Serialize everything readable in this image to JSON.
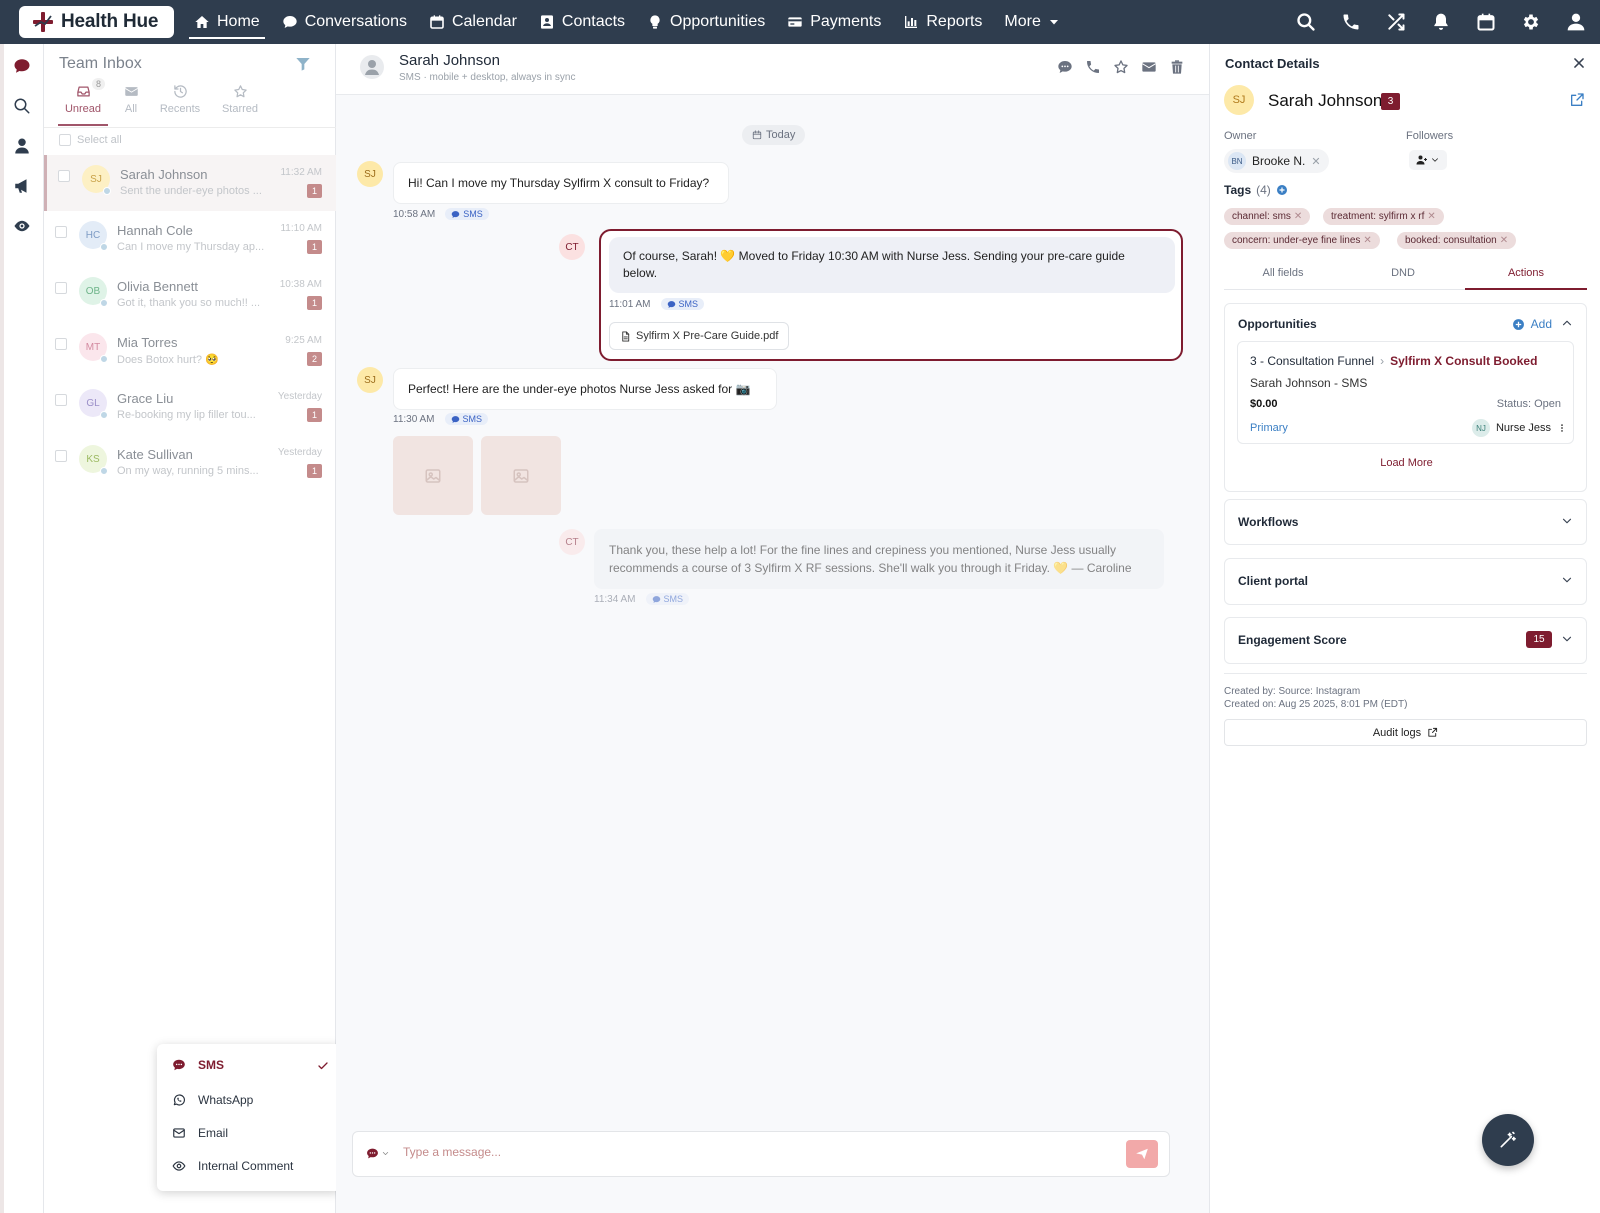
{
  "brand": {
    "name": "Health Hue"
  },
  "nav": [
    {
      "label": "Home",
      "icon": "home-icon",
      "active": true
    },
    {
      "label": "Conversations",
      "icon": "chat-icon"
    },
    {
      "label": "Calendar",
      "icon": "calendar-icon"
    },
    {
      "label": "Contacts",
      "icon": "contacts-icon"
    },
    {
      "label": "Opportunities",
      "icon": "lightbulb-icon"
    },
    {
      "label": "Payments",
      "icon": "card-icon"
    },
    {
      "label": "Reports",
      "icon": "bar-chart-icon"
    },
    {
      "label": "More",
      "icon": "caret-down-icon"
    }
  ],
  "top_icons": [
    "search-icon",
    "phone-icon",
    "shuffle-icon",
    "bell-icon",
    "calendar-icon",
    "gear-icon",
    "user-icon"
  ],
  "rail_icons": [
    "chat-icon",
    "search-icon",
    "user-icon",
    "megaphone-icon",
    "eye-icon"
  ],
  "inbox": {
    "title": "Team Inbox",
    "unread_count": "8",
    "tabs": [
      {
        "label": "Unread",
        "icon": "inbox-icon",
        "active": true
      },
      {
        "label": "All",
        "icon": "mail-icon"
      },
      {
        "label": "Recents",
        "icon": "history-icon"
      },
      {
        "label": "Starred",
        "icon": "star-icon"
      }
    ],
    "select_all": "Select all",
    "conversations": [
      {
        "initials": "SJ",
        "name": "Sarah Johnson",
        "preview": "Sent the under-eye photos ...",
        "time": "11:32 AM",
        "badge": "1",
        "bg": "#fdf0c4",
        "fg": "#c9a24a"
      },
      {
        "initials": "HC",
        "name": "Hannah Cole",
        "preview": "Can I move my Thursday ap...",
        "time": "11:10 AM",
        "badge": "1",
        "bg": "#e3ecf7",
        "fg": "#7d9bc4"
      },
      {
        "initials": "OB",
        "name": "Olivia Bennett",
        "preview": "Got it, thank you so much!! ...",
        "time": "10:38 AM",
        "badge": "1",
        "bg": "#dff3e7",
        "fg": "#6fb48a"
      },
      {
        "initials": "MT",
        "name": "Mia Torres",
        "preview": "Does Botox hurt? 🥺",
        "time": "9:25 AM",
        "badge": "2",
        "bg": "#fbe6ec",
        "fg": "#d38aa0"
      },
      {
        "initials": "GL",
        "name": "Grace Liu",
        "preview": "Re-booking my lip filler tou...",
        "time": "Yesterday",
        "badge": "1",
        "bg": "#ece8f8",
        "fg": "#9b8fc8"
      },
      {
        "initials": "KS",
        "name": "Kate Sullivan",
        "preview": "On my way, running 5 mins...",
        "time": "Yesterday",
        "badge": "1",
        "bg": "#eef6de",
        "fg": "#9cba62"
      }
    ]
  },
  "channel_menu": {
    "items": [
      {
        "label": "SMS",
        "icon": "sms-icon",
        "selected": true
      },
      {
        "label": "WhatsApp",
        "icon": "whatsapp-icon"
      },
      {
        "label": "Email",
        "icon": "mail-icon"
      },
      {
        "label": "Internal Comment",
        "icon": "eye-icon"
      }
    ]
  },
  "chat": {
    "contact_name": "Sarah Johnson",
    "subtitle": "SMS · mobile + desktop, always in sync",
    "header_actions": [
      "chat-icon",
      "phone-icon",
      "star-icon",
      "mail-icon",
      "trash-icon"
    ],
    "date_divider": "Today",
    "messages": [
      {
        "from": "SJ",
        "text": "Hi! Can I move my Thursday Sylfirm X consult to Friday?",
        "time": "10:58 AM",
        "channel": "SMS"
      },
      {
        "from": "CT",
        "text": "Of course, Sarah! 💛 Moved to Friday 10:30 AM with Nurse Jess. Sending your pre-care guide below.",
        "time": "11:01 AM",
        "channel": "SMS",
        "attachment": "Sylfirm X Pre-Care Guide.pdf"
      },
      {
        "from": "SJ",
        "text": "Perfect! Here are the under-eye photos Nurse Jess asked for 📷",
        "time": "11:30 AM",
        "channel": "SMS"
      },
      {
        "from": "CT",
        "text": "Thank you, these help a lot! For the fine lines and crepiness you mentioned, Nurse Jess usually recommends a course of 3 Sylfirm X RF sessions. She'll walk you through it Friday. 💛 — Caroline",
        "time": "11:34 AM",
        "channel": "SMS"
      }
    ],
    "composer_placeholder": "Type a message..."
  },
  "details": {
    "title": "Contact Details",
    "initials": "SJ",
    "name": "Sarah Johnson",
    "badge": "3",
    "owner_label": "Owner",
    "owner_initials": "BN",
    "owner_name": "Brooke N.",
    "followers_label": "Followers",
    "tags_label": "Tags",
    "tags_count": "(4)",
    "tags": [
      "channel: sms",
      "treatment: sylfirm x rf",
      "concern: under-eye fine lines",
      "booked: consultation"
    ],
    "tabs": [
      "All fields",
      "DND",
      "Actions"
    ],
    "active_tab": "Actions",
    "opportunities": {
      "title": "Opportunities",
      "add_label": "Add",
      "pipeline": "3 - Consultation Funnel",
      "separator": "›",
      "stage": "Sylfirm X Consult Booked",
      "contact": "Sarah Johnson - SMS",
      "amount": "$0.00",
      "status": "Status: Open",
      "primary": "Primary",
      "owner_initials": "NJ",
      "owner_name": "Nurse Jess",
      "load_more": "Load More"
    },
    "sections": [
      "Workflows",
      "Client portal",
      "Engagement Score"
    ],
    "engagement_score": "15",
    "created_by": "Created by: Source: Instagram",
    "created_on": "Created on: Aug 25 2025, 8:01 PM (EDT)",
    "audit_logs": "Audit logs"
  },
  "colors": {
    "topbar": "#2f3d4e",
    "accent": "#7e1c2f",
    "link": "#3b7fc4",
    "send_button": "#f2a9a9"
  }
}
